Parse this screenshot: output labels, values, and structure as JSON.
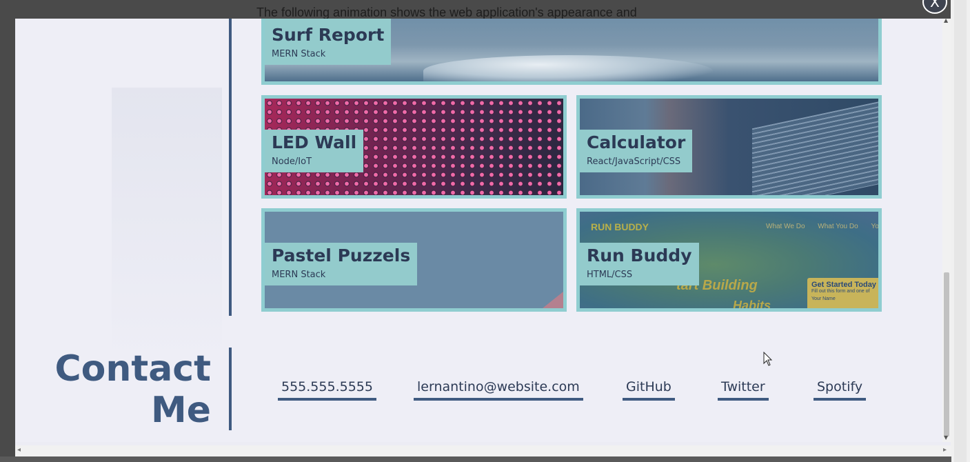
{
  "background": {
    "intro_text": "The following animation shows the web application's appearance and"
  },
  "modal": {
    "close_label": "X"
  },
  "projects": [
    {
      "title": "Surf Report",
      "tech": "MERN Stack"
    },
    {
      "title": "LED Wall",
      "tech": "Node/IoT"
    },
    {
      "title": "Calculator",
      "tech": "React/JavaScript/CSS"
    },
    {
      "title": "Pastel Puzzels",
      "tech": "MERN Stack"
    },
    {
      "title": "Run Buddy",
      "tech": "HTML/CSS",
      "screenshot_text": {
        "brand": "RUN BUDDY",
        "nav": [
          "What We Do",
          "What You Do",
          "Yo"
        ],
        "hero": "tart Building",
        "hero2": "Habits",
        "cta_title": "Get Started Today",
        "cta_sub": "Fill out this form and one of",
        "cta_field": "Your Name"
      }
    }
  ],
  "contact": {
    "heading_line1": "Contact",
    "heading_line2": "Me",
    "links": [
      "555.555.5555",
      "lernantino@website.com",
      "GitHub",
      "Twitter",
      "Spotify"
    ]
  },
  "colors": {
    "accent": "#3f5a80",
    "card_border": "#8fcdd0",
    "label_bg": "#93cbcc",
    "modal_bg": "#eeeef6"
  }
}
